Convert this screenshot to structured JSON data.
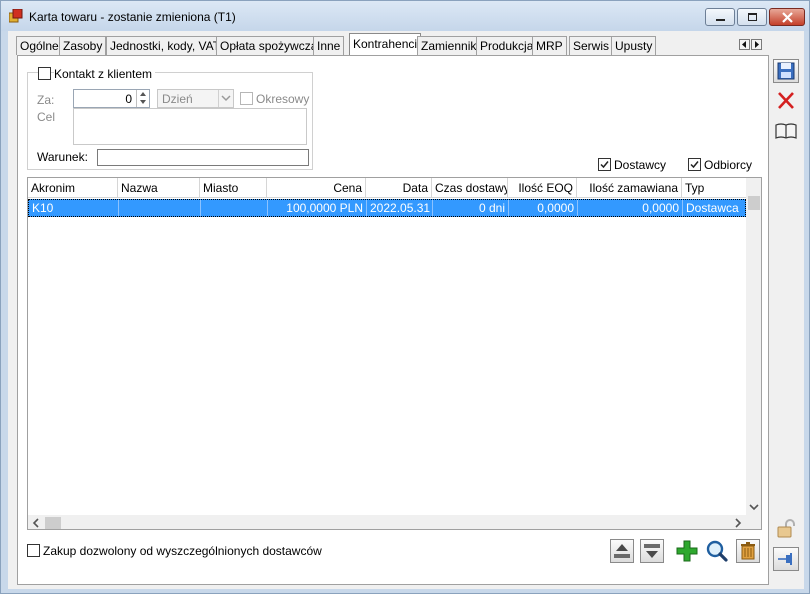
{
  "window": {
    "title": "Karta towaru - zostanie zmieniona (T1)"
  },
  "tabs": [
    {
      "label": "Ogólne"
    },
    {
      "label": "Zasoby"
    },
    {
      "label": "Jednostki, kody, VAT"
    },
    {
      "label": "Opłata spożywcza"
    },
    {
      "label": "Inne"
    },
    {
      "label": "Kontrahenci",
      "active": true
    },
    {
      "label": "Zamienniki"
    },
    {
      "label": "Produkcja"
    },
    {
      "label": "MRP"
    },
    {
      "label": "Serwis"
    },
    {
      "label": "Upusty"
    }
  ],
  "contact": {
    "checkbox_label": "Kontakt z klientem",
    "checked": false,
    "za_label": "Za:",
    "za_value": "0",
    "unit_value": "Dzień",
    "periodic_label": "Okresowy",
    "cel_label": "Cel",
    "cel_value": "",
    "warunek_label": "Warunek:",
    "warunek_value": ""
  },
  "filters": {
    "dostawcy_label": "Dostawcy",
    "dostawcy_checked": true,
    "odbiorcy_label": "Odbiorcy",
    "odbiorcy_checked": true
  },
  "table": {
    "columns": [
      "Akronim",
      "Nazwa",
      "Miasto",
      "Cena",
      "Data",
      "Czas dostawy",
      "Ilość EOQ",
      "Ilość zamawiana",
      "Typ"
    ],
    "rows": [
      {
        "akronim": "K10",
        "nazwa": "",
        "miasto": "",
        "cena": "100,0000 PLN",
        "data": "2022.05.31",
        "czas": "0 dni",
        "eoq": "0,0000",
        "zamawiana": "0,0000",
        "typ": "Dostawca",
        "selected": true
      }
    ]
  },
  "footer": {
    "restricted_label": "Zakup dozwolony od wyszczególnionych dostawców",
    "restricted_checked": false
  },
  "icons": {
    "app": "app-icon",
    "save": "save-icon",
    "cancel": "close-icon",
    "book": "book-icon",
    "lock": "lock-icon",
    "pin": "pin-icon",
    "up": "move-up-icon",
    "down": "move-down-icon",
    "add": "plus-icon",
    "search": "search-icon",
    "delete": "trash-icon"
  },
  "colors": {
    "selection": "#3399ff",
    "add_green": "#2ea82e",
    "cancel_red": "#d42020"
  }
}
